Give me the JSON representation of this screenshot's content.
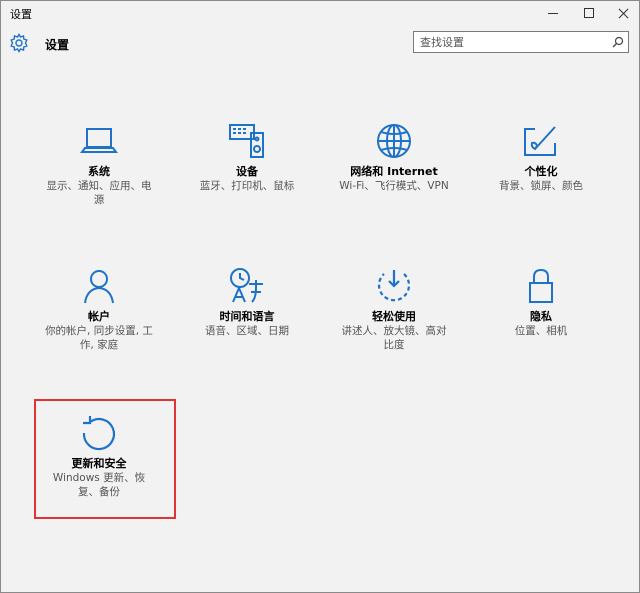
{
  "window": {
    "title": "设置"
  },
  "header": {
    "title": "设置"
  },
  "search": {
    "placeholder": "查找设置"
  },
  "accent": "#1e73c8",
  "highlight_color": "#e03333",
  "tiles": [
    {
      "name": "系统",
      "desc": "显示、通知、应用、电源",
      "icon": "laptop-icon"
    },
    {
      "name": "设备",
      "desc": "蓝牙、打印机、鼠标",
      "icon": "devices-icon"
    },
    {
      "name": "网络和 Internet",
      "desc": "Wi-Fi、飞行模式、VPN",
      "icon": "globe-icon"
    },
    {
      "name": "个性化",
      "desc": "背景、锁屏、颜色",
      "icon": "paint-icon"
    },
    {
      "name": "帐户",
      "desc": "你的帐户, 同步设置, 工作, 家庭",
      "icon": "person-icon"
    },
    {
      "name": "时间和语言",
      "desc": "语音、区域、日期",
      "icon": "time-language-icon"
    },
    {
      "name": "轻松使用",
      "desc": "讲述人、放大镜、高对比度",
      "icon": "ease-of-access-icon"
    },
    {
      "name": "隐私",
      "desc": "位置、相机",
      "icon": "lock-icon"
    },
    {
      "name": "更新和安全",
      "desc": "Windows 更新、恢复、备份",
      "icon": "update-icon"
    }
  ]
}
